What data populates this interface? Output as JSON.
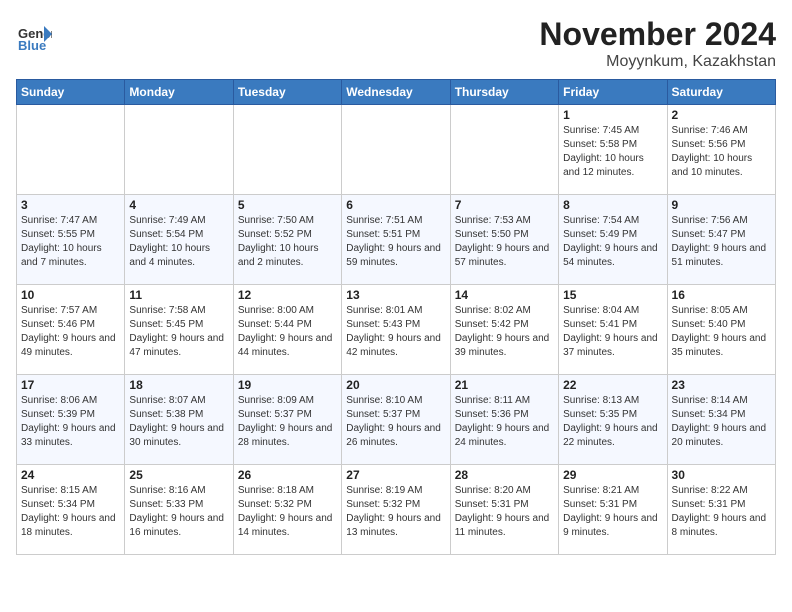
{
  "header": {
    "logo_general": "General",
    "logo_blue": "Blue",
    "month_title": "November 2024",
    "location": "Moyynkum, Kazakhstan"
  },
  "calendar": {
    "weekdays": [
      "Sunday",
      "Monday",
      "Tuesday",
      "Wednesday",
      "Thursday",
      "Friday",
      "Saturday"
    ],
    "weeks": [
      [
        {
          "day": "",
          "info": ""
        },
        {
          "day": "",
          "info": ""
        },
        {
          "day": "",
          "info": ""
        },
        {
          "day": "",
          "info": ""
        },
        {
          "day": "",
          "info": ""
        },
        {
          "day": "1",
          "info": "Sunrise: 7:45 AM\nSunset: 5:58 PM\nDaylight: 10 hours and 12 minutes."
        },
        {
          "day": "2",
          "info": "Sunrise: 7:46 AM\nSunset: 5:56 PM\nDaylight: 10 hours and 10 minutes."
        }
      ],
      [
        {
          "day": "3",
          "info": "Sunrise: 7:47 AM\nSunset: 5:55 PM\nDaylight: 10 hours and 7 minutes."
        },
        {
          "day": "4",
          "info": "Sunrise: 7:49 AM\nSunset: 5:54 PM\nDaylight: 10 hours and 4 minutes."
        },
        {
          "day": "5",
          "info": "Sunrise: 7:50 AM\nSunset: 5:52 PM\nDaylight: 10 hours and 2 minutes."
        },
        {
          "day": "6",
          "info": "Sunrise: 7:51 AM\nSunset: 5:51 PM\nDaylight: 9 hours and 59 minutes."
        },
        {
          "day": "7",
          "info": "Sunrise: 7:53 AM\nSunset: 5:50 PM\nDaylight: 9 hours and 57 minutes."
        },
        {
          "day": "8",
          "info": "Sunrise: 7:54 AM\nSunset: 5:49 PM\nDaylight: 9 hours and 54 minutes."
        },
        {
          "day": "9",
          "info": "Sunrise: 7:56 AM\nSunset: 5:47 PM\nDaylight: 9 hours and 51 minutes."
        }
      ],
      [
        {
          "day": "10",
          "info": "Sunrise: 7:57 AM\nSunset: 5:46 PM\nDaylight: 9 hours and 49 minutes."
        },
        {
          "day": "11",
          "info": "Sunrise: 7:58 AM\nSunset: 5:45 PM\nDaylight: 9 hours and 47 minutes."
        },
        {
          "day": "12",
          "info": "Sunrise: 8:00 AM\nSunset: 5:44 PM\nDaylight: 9 hours and 44 minutes."
        },
        {
          "day": "13",
          "info": "Sunrise: 8:01 AM\nSunset: 5:43 PM\nDaylight: 9 hours and 42 minutes."
        },
        {
          "day": "14",
          "info": "Sunrise: 8:02 AM\nSunset: 5:42 PM\nDaylight: 9 hours and 39 minutes."
        },
        {
          "day": "15",
          "info": "Sunrise: 8:04 AM\nSunset: 5:41 PM\nDaylight: 9 hours and 37 minutes."
        },
        {
          "day": "16",
          "info": "Sunrise: 8:05 AM\nSunset: 5:40 PM\nDaylight: 9 hours and 35 minutes."
        }
      ],
      [
        {
          "day": "17",
          "info": "Sunrise: 8:06 AM\nSunset: 5:39 PM\nDaylight: 9 hours and 33 minutes."
        },
        {
          "day": "18",
          "info": "Sunrise: 8:07 AM\nSunset: 5:38 PM\nDaylight: 9 hours and 30 minutes."
        },
        {
          "day": "19",
          "info": "Sunrise: 8:09 AM\nSunset: 5:37 PM\nDaylight: 9 hours and 28 minutes."
        },
        {
          "day": "20",
          "info": "Sunrise: 8:10 AM\nSunset: 5:37 PM\nDaylight: 9 hours and 26 minutes."
        },
        {
          "day": "21",
          "info": "Sunrise: 8:11 AM\nSunset: 5:36 PM\nDaylight: 9 hours and 24 minutes."
        },
        {
          "day": "22",
          "info": "Sunrise: 8:13 AM\nSunset: 5:35 PM\nDaylight: 9 hours and 22 minutes."
        },
        {
          "day": "23",
          "info": "Sunrise: 8:14 AM\nSunset: 5:34 PM\nDaylight: 9 hours and 20 minutes."
        }
      ],
      [
        {
          "day": "24",
          "info": "Sunrise: 8:15 AM\nSunset: 5:34 PM\nDaylight: 9 hours and 18 minutes."
        },
        {
          "day": "25",
          "info": "Sunrise: 8:16 AM\nSunset: 5:33 PM\nDaylight: 9 hours and 16 minutes."
        },
        {
          "day": "26",
          "info": "Sunrise: 8:18 AM\nSunset: 5:32 PM\nDaylight: 9 hours and 14 minutes."
        },
        {
          "day": "27",
          "info": "Sunrise: 8:19 AM\nSunset: 5:32 PM\nDaylight: 9 hours and 13 minutes."
        },
        {
          "day": "28",
          "info": "Sunrise: 8:20 AM\nSunset: 5:31 PM\nDaylight: 9 hours and 11 minutes."
        },
        {
          "day": "29",
          "info": "Sunrise: 8:21 AM\nSunset: 5:31 PM\nDaylight: 9 hours and 9 minutes."
        },
        {
          "day": "30",
          "info": "Sunrise: 8:22 AM\nSunset: 5:31 PM\nDaylight: 9 hours and 8 minutes."
        }
      ]
    ]
  }
}
